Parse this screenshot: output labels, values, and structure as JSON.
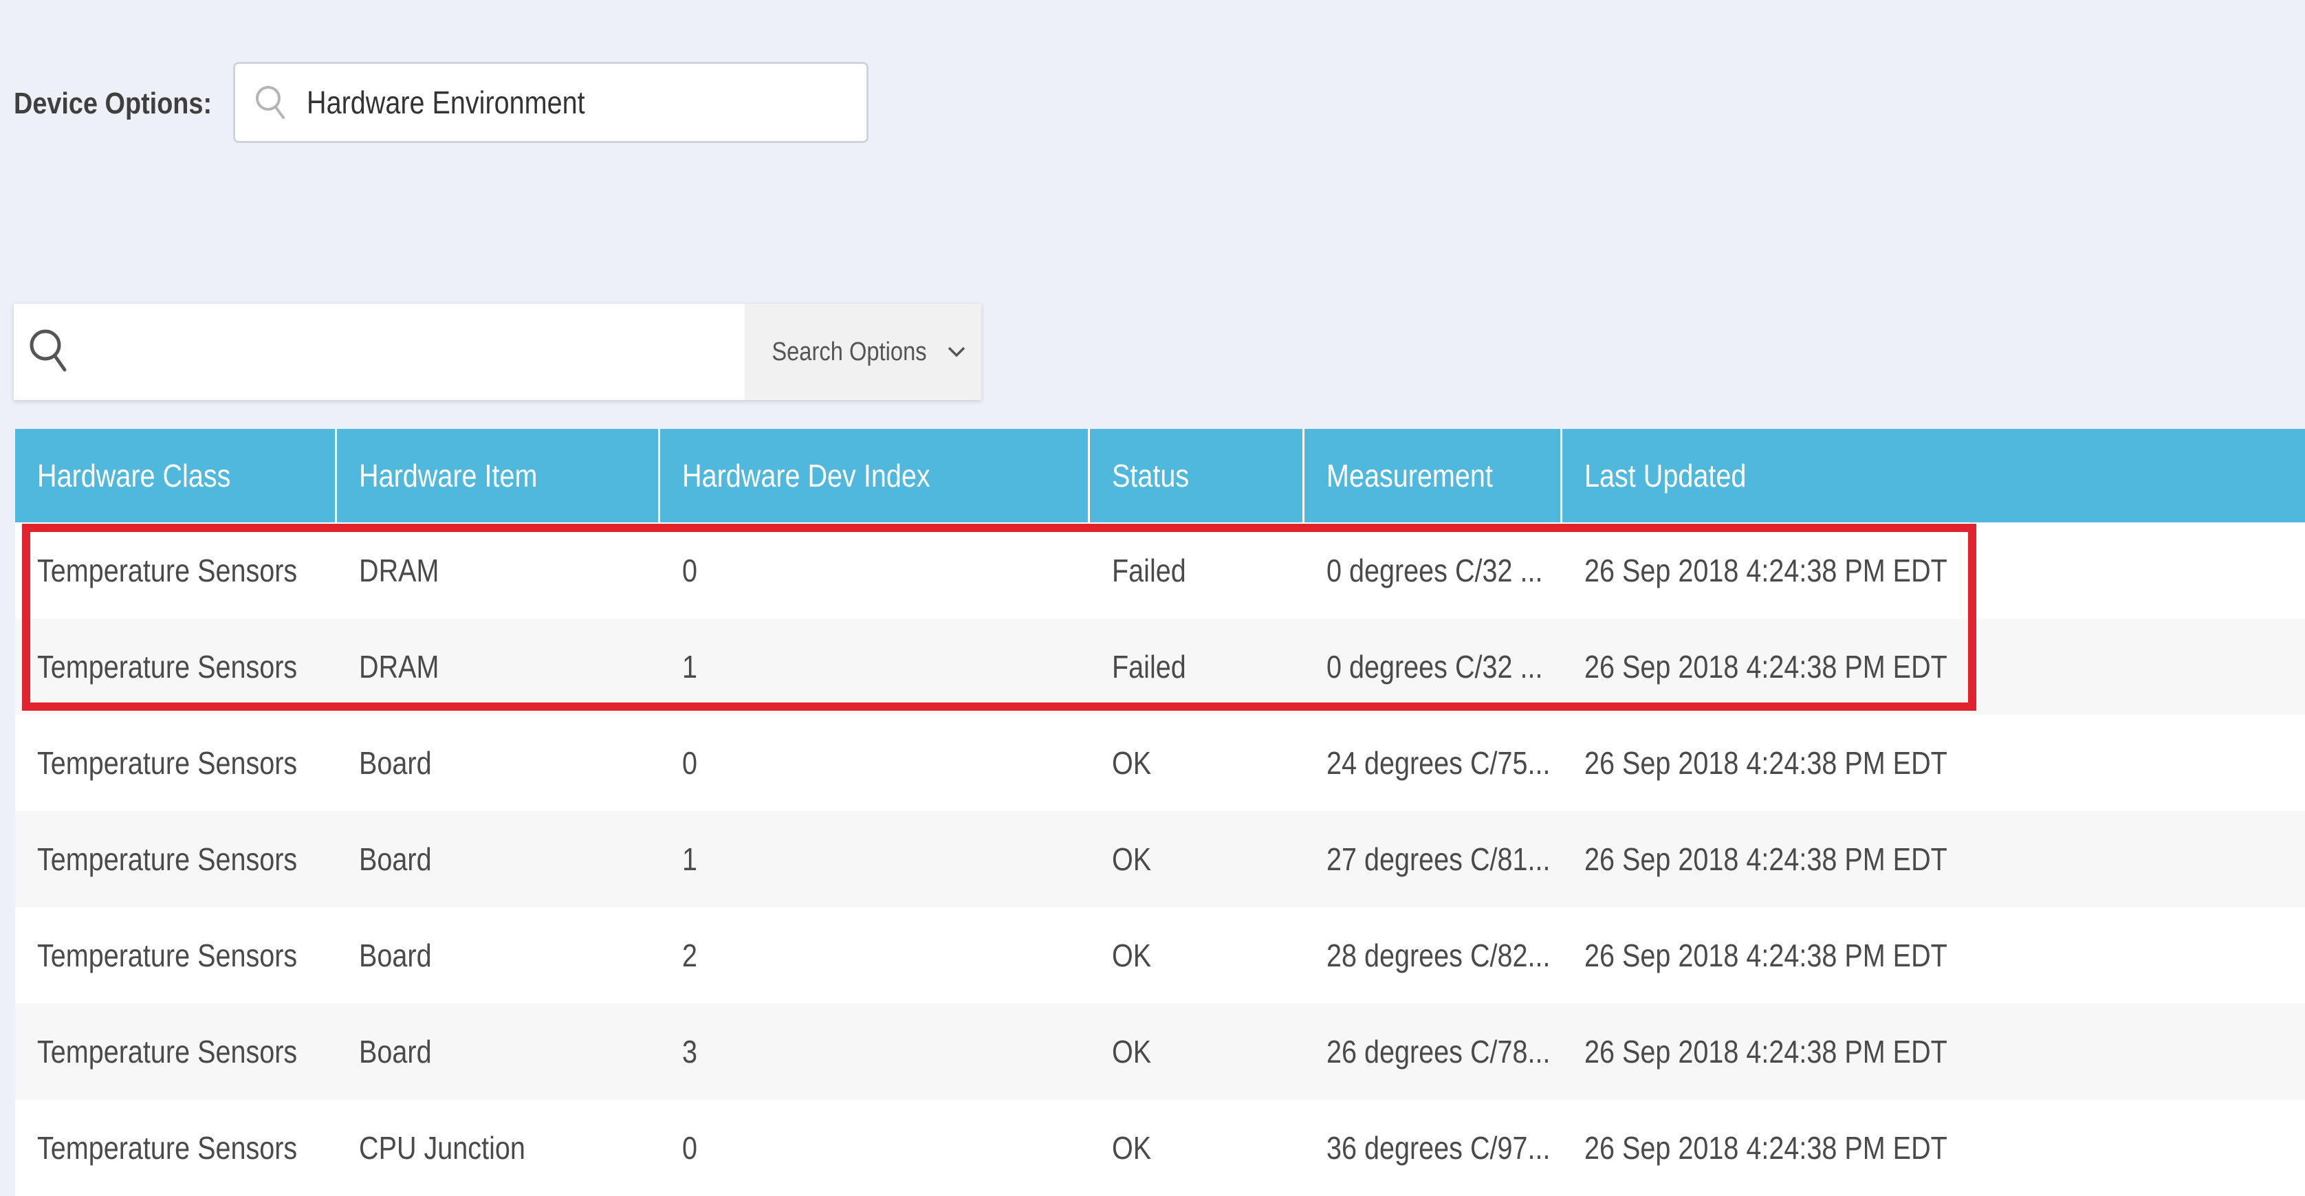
{
  "device_options": {
    "label": "Device Options:",
    "selected_value": "Hardware Environment",
    "icon": "search-icon"
  },
  "search": {
    "placeholder": "",
    "icon": "search-icon",
    "options_label": "Search Options",
    "options_icon": "chevron-down-icon"
  },
  "table": {
    "columns": [
      "Hardware Class",
      "Hardware Item",
      "Hardware Dev Index",
      "Status",
      "Measurement",
      "Last Updated"
    ],
    "rows": [
      [
        "Temperature Sensors",
        "DRAM",
        "0",
        "Failed",
        "0 degrees C/32 ...",
        "26 Sep 2018 4:24:38 PM EDT"
      ],
      [
        "Temperature Sensors",
        "DRAM",
        "1",
        "Failed",
        "0 degrees C/32 ...",
        "26 Sep 2018 4:24:38 PM EDT"
      ],
      [
        "Temperature Sensors",
        "Board",
        "0",
        "OK",
        "24 degrees C/75...",
        "26 Sep 2018 4:24:38 PM EDT"
      ],
      [
        "Temperature Sensors",
        "Board",
        "1",
        "OK",
        "27 degrees C/81...",
        "26 Sep 2018 4:24:38 PM EDT"
      ],
      [
        "Temperature Sensors",
        "Board",
        "2",
        "OK",
        "28 degrees C/82...",
        "26 Sep 2018 4:24:38 PM EDT"
      ],
      [
        "Temperature Sensors",
        "Board",
        "3",
        "OK",
        "26 degrees C/78...",
        "26 Sep 2018 4:24:38 PM EDT"
      ],
      [
        "Temperature Sensors",
        "CPU Junction",
        "0",
        "OK",
        "36 degrees C/97...",
        "26 Sep 2018 4:24:38 PM EDT"
      ]
    ]
  },
  "colors": {
    "header_bg": "#4fb8dc",
    "highlight": "#e0232d",
    "page_bg": "#edf0f6"
  }
}
